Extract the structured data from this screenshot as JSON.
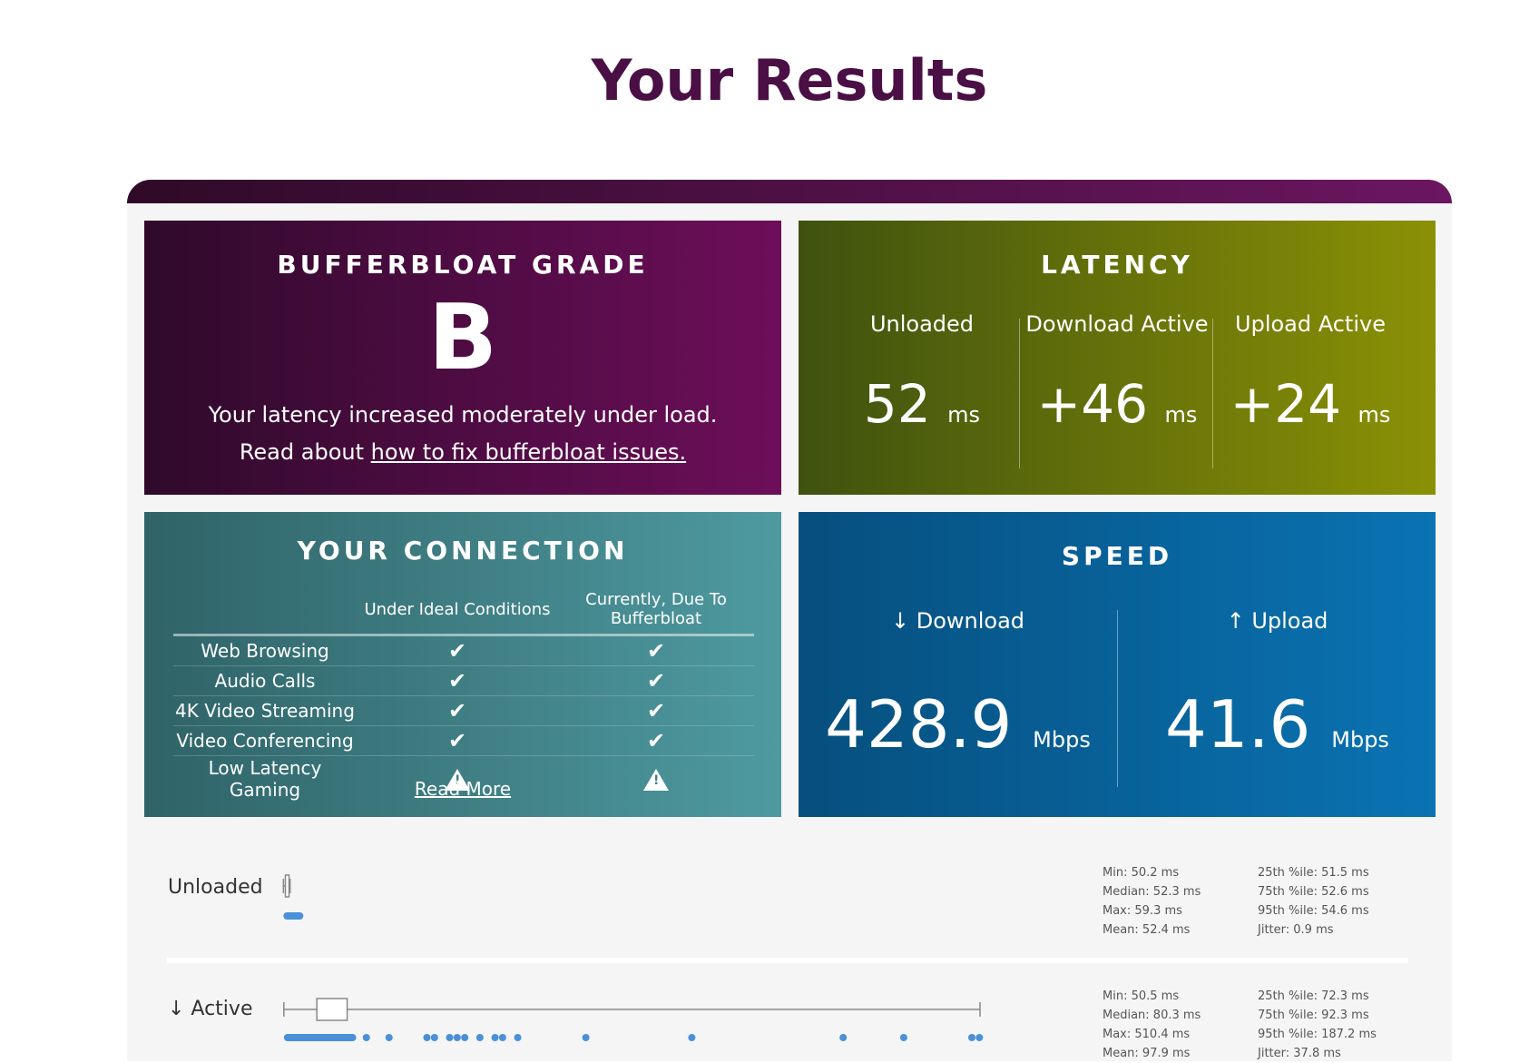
{
  "page_title": "Your Results",
  "grade_card": {
    "title": "BUFFERBLOAT GRADE",
    "grade": "B",
    "description": "Your latency increased moderately under load.",
    "link_prefix": "Read about ",
    "link_text": "how to fix bufferbloat issues."
  },
  "latency_card": {
    "title": "LATENCY",
    "columns": [
      {
        "label": "Unloaded",
        "value": "52",
        "unit": "ms"
      },
      {
        "label": "Download Active",
        "value": "+46",
        "unit": "ms"
      },
      {
        "label": "Upload Active",
        "value": "+24",
        "unit": "ms"
      }
    ]
  },
  "connection_card": {
    "title": "YOUR CONNECTION",
    "headers": [
      "",
      "Under Ideal Conditions",
      "Currently, Due To Bufferbloat"
    ],
    "rows": [
      {
        "feature": "Web Browsing",
        "ideal": "check",
        "current": "check"
      },
      {
        "feature": "Audio Calls",
        "ideal": "check",
        "current": "check"
      },
      {
        "feature": "4K Video Streaming",
        "ideal": "check",
        "current": "check"
      },
      {
        "feature": "Video Conferencing",
        "ideal": "check",
        "current": "check"
      },
      {
        "feature": "Low Latency Gaming",
        "ideal": "warning",
        "current": "warning"
      }
    ],
    "read_more": "Read More"
  },
  "speed_card": {
    "title": "SPEED",
    "download": {
      "label": "↓ Download",
      "value": "428.9",
      "unit": "Mbps"
    },
    "upload": {
      "label": "↑ Upload",
      "value": "41.6",
      "unit": "Mbps"
    }
  },
  "latency_detail": {
    "unloaded": {
      "label": "Unloaded",
      "stats_left": [
        "Min: 50.2 ms",
        "Median: 52.3 ms",
        "Max: 59.3 ms",
        "Mean: 52.4 ms"
      ],
      "stats_right": [
        "25th %ile: 51.5 ms",
        "75th %ile: 52.6 ms",
        "95th %ile: 54.6 ms",
        "Jitter: 0.9 ms"
      ]
    },
    "active": {
      "label": "↓ Active",
      "stats_left": [
        "Min: 50.5 ms",
        "Median: 80.3 ms",
        "Max: 510.4 ms",
        "Mean: 97.9 ms"
      ],
      "stats_right": [
        "25th %ile: 72.3 ms",
        "75th %ile: 92.3 ms",
        "95th %ile: 187.2 ms",
        "Jitter: 37.8 ms"
      ]
    },
    "colors": {
      "point": "#4a90d9",
      "whisker": "#888888"
    }
  }
}
